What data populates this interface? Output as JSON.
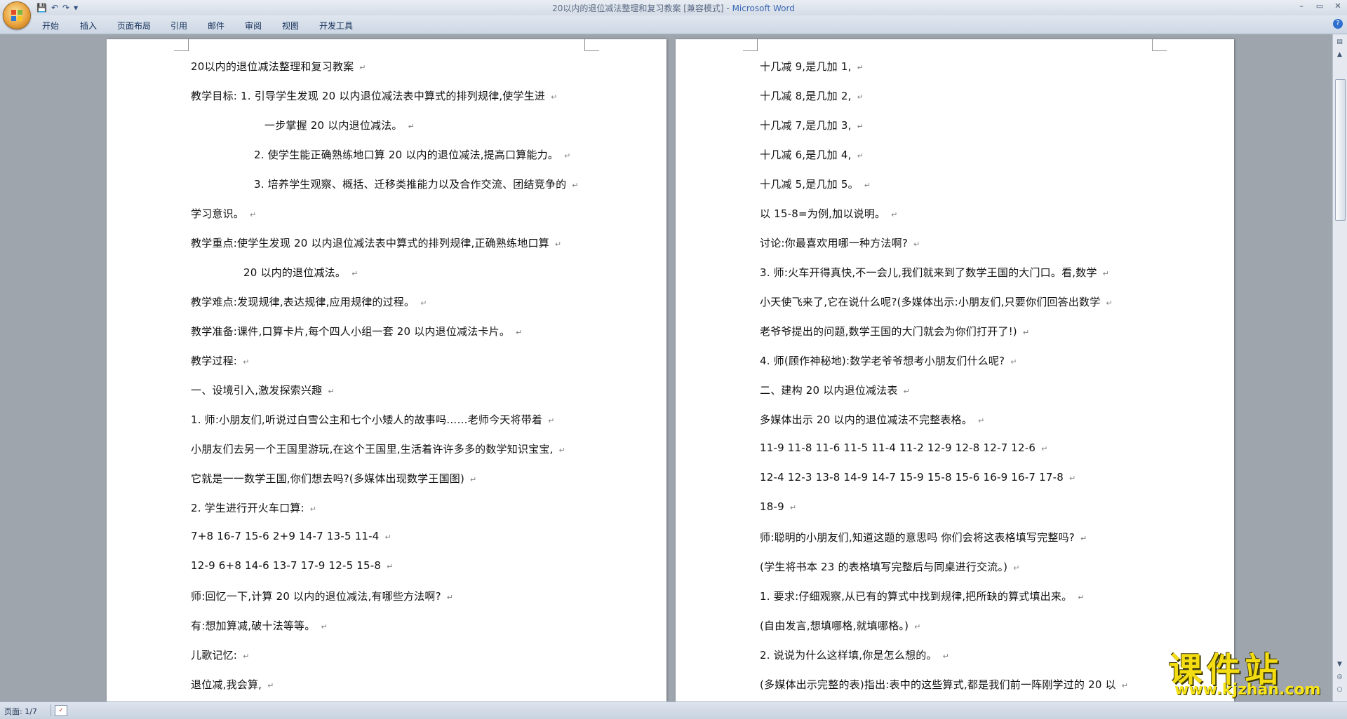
{
  "window": {
    "title_doc": "20以内的退位减法整理和复习教案 [兼容模式] - ",
    "title_app": "Microsoft Word",
    "controls": {
      "minimize": "–",
      "maximize": "▭",
      "close": "✕"
    }
  },
  "quick_access": {
    "save": "💾",
    "undo": "↶",
    "redo": "↷",
    "customize": "▾"
  },
  "ribbon_tabs": [
    "开始",
    "插入",
    "页面布局",
    "引用",
    "邮件",
    "审阅",
    "视图",
    "开发工具"
  ],
  "help_label": "?",
  "status_bar": {
    "page": "页面: 1/7"
  },
  "scrollbar": {
    "up": "▲",
    "down": "▼",
    "prev": "◎",
    "next": "○"
  },
  "watermark": {
    "top": "课件站",
    "bottom": "www.kjzhan.com"
  },
  "paragraph_mark": "↵",
  "left_page": [
    "20以内的退位减法整理和复习教案",
    "教学目标:  1. 引导学生发现 20 以内退位减法表中算式的排列规律,使学生进",
    "一步掌握 20 以内退位减法。",
    "2. 使学生能正确熟练地口算 20 以内的退位减法,提高口算能力。",
    "3. 培养学生观察、概括、迁移类推能力以及合作交流、团结竞争的",
    "学习意识。",
    "教学重点:使学生发现 20 以内退位减法表中算式的排列规律,正确熟练地口算",
    "20 以内的退位减法。",
    "教学难点:发现规律,表达规律,应用规律的过程。",
    "教学准备:课件,口算卡片,每个四人小组一套 20 以内退位减法卡片。",
    "教学过程:",
    "一、设境引入,激发探索兴趣",
    "1. 师:小朋友们,听说过白雪公主和七个小矮人的故事吗……老师今天将带着",
    "小朋友们去另一个王国里游玩,在这个王国里,生活着许许多多的数学知识宝宝,",
    "它就是一一数学王国,你们想去吗?(多媒体出现数学王国图)",
    "2. 学生进行开火车口算:",
    "7+8 16-7 15-6 2+9 14-7 13-5 11-4",
    "12-9 6+8 14-6 13-7 17-9 12-5 15-8",
    "师:回忆一下,计算 20 以内的退位减法,有哪些方法啊?",
    "有:想加算减,破十法等等。",
    "儿歌记忆:",
    "退位减,我会算,"
  ],
  "right_page": [
    "十几减 9,是几加 1,",
    "十几减 8,是几加 2,",
    "十几减 7,是几加 3,",
    "十几减 6,是几加 4,",
    "十几减 5,是几加 5。",
    "以 15-8=为例,加以说明。",
    "讨论:你最喜欢用哪一种方法啊?",
    "3. 师:火车开得真快,不一会儿,我们就来到了数学王国的大门口。看,数学",
    "小天使飞来了,它在说什么呢?(多媒体出示:小朋友们,只要你们回答出数学",
    "老爷爷提出的问题,数学王国的大门就会为你们打开了!)",
    "4. 师(顾作神秘地):数学老爷爷想考小朋友们什么呢?",
    "二、建构 20 以内退位减法表",
    "多媒体出示 20 以内的退位减法不完整表格。",
    "11-9    11-8    11-6    11-5    11-4    11-2 12-9    12-8    12-7    12-6",
    "12-4    12-3    13-8    14-9    14-7    15-9    15-8 15-6    16-9 16-7    17-8",
    "18-9",
    "师:聪明的小朋友们,知道这题的意思吗 你们会将这表格填写完整吗?",
    "(学生将书本 23 的表格填写完整后与同桌进行交流。)",
    "1. 要求:仔细观察,从已有的算式中找到规律,把所缺的算式填出来。",
    "(自由发言,想填哪格,就填哪格。)",
    "2. 说说为什么这样填,你是怎么想的。",
    "(多媒体出示完整的表)指出:表中的这些算式,都是我们前一阵刚学过的 20 以"
  ]
}
